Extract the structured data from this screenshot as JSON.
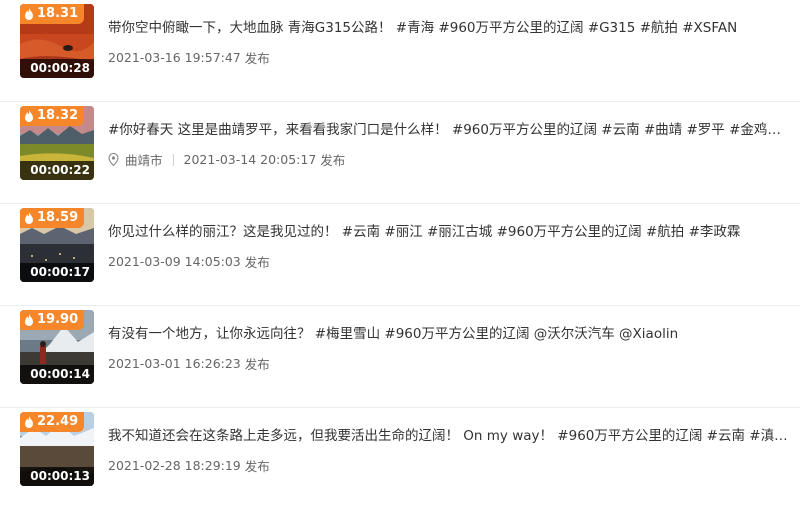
{
  "videos": [
    {
      "heat": "18.31",
      "duration": "00:00:28",
      "title": "带你空中俯瞰一下，大地血脉 青海G315公路！ #青海 #960万平方公里的辽阔 #G315 #航拍 #XSFAN",
      "location": "",
      "datetime": "2021-03-16 19:57:47",
      "published": "发布"
    },
    {
      "heat": "18.32",
      "duration": "00:00:22",
      "title": "#你好春天 这里是曲靖罗平，来看看我家门口是什么样！ #960万平方公里的辽阔 #云南 #曲靖 #罗平 #金鸡峰丛 #油…",
      "location": "曲靖市",
      "datetime": "2021-03-14 20:05:17",
      "published": "发布"
    },
    {
      "heat": "18.59",
      "duration": "00:00:17",
      "title": "你见过什么样的丽江？这是我见过的！ #云南 #丽江 #丽江古城 #960万平方公里的辽阔 #航拍 #李政霖",
      "location": "",
      "datetime": "2021-03-09 14:05:03",
      "published": "发布"
    },
    {
      "heat": "19.90",
      "duration": "00:00:14",
      "title": "有没有一个地方，让你永远向往？ #梅里雪山 #960万平方公里的辽阔 @沃尔沃汽车 @Xiaolin",
      "location": "",
      "datetime": "2021-03-01 16:26:23",
      "published": "发布"
    },
    {
      "heat": "22.49",
      "duration": "00:00:13",
      "title": "我不知道还会在这条路上走多远，但我要活出生命的辽阔！ On my way！ #960万平方公里的辽阔 #云南 #滇西 #沃…",
      "location": "",
      "datetime": "2021-02-28 18:29:19",
      "published": "发布"
    }
  ],
  "colors": {
    "badge": "#f5862a",
    "text": "#333333",
    "meta": "#666666"
  }
}
